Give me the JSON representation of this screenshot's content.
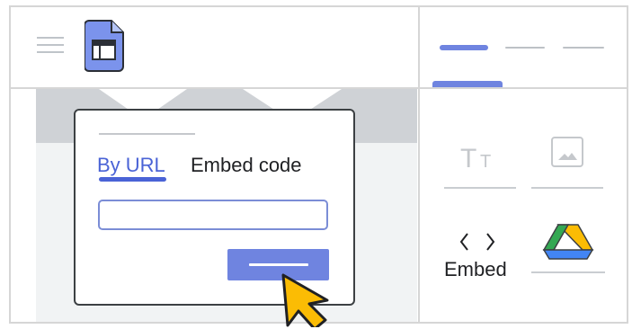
{
  "dialog": {
    "tabs": [
      {
        "label": "By URL"
      },
      {
        "label": "Embed code"
      }
    ]
  },
  "sidebar": {
    "insert_items": [
      {
        "label": "",
        "icon": "text-box-icon"
      },
      {
        "label": "",
        "icon": "image-icon"
      },
      {
        "label": "Embed",
        "icon": "embed-code-icon"
      },
      {
        "label": "",
        "icon": "drive-icon"
      }
    ]
  },
  "colors": {
    "accent": "#6f84e0",
    "active_tab": "#4a63d6",
    "border": "#d6d6d6",
    "cursor": "#fbbc04"
  }
}
